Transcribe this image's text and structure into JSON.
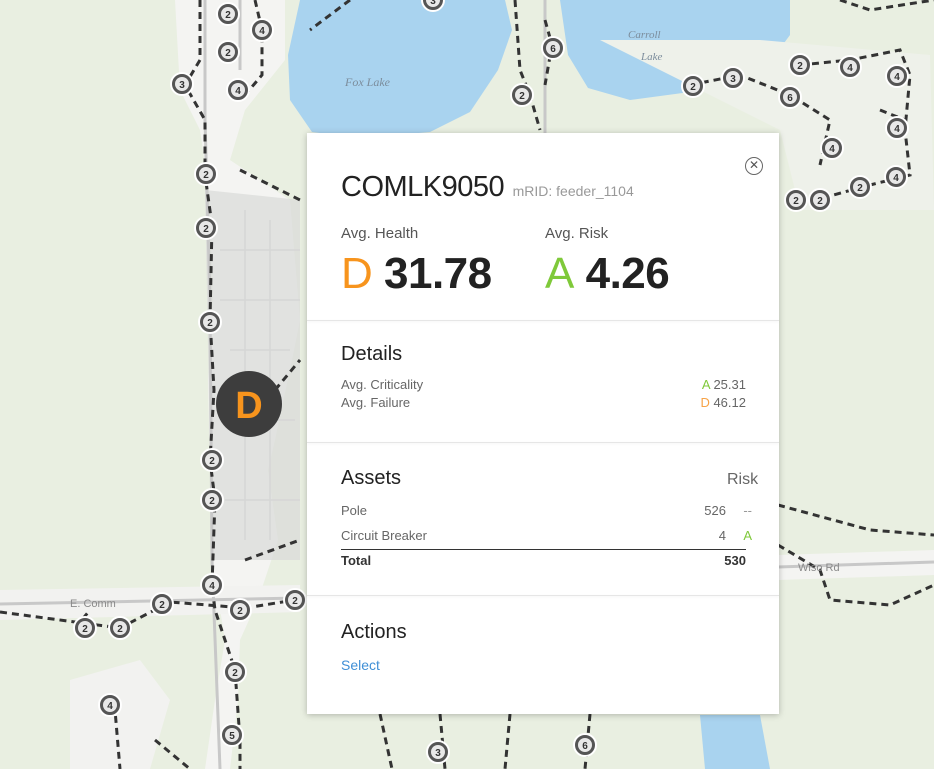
{
  "map": {
    "lakes": [
      {
        "name": "Fox Lake"
      },
      {
        "name_line1": "Carroll",
        "name_line2": "Lake"
      }
    ],
    "roads": [
      "E. Comm",
      "Wiso Rd"
    ],
    "feeder_marker_grade": "D",
    "feeder_marker_color": "#f7941d"
  },
  "popup": {
    "feeder_name": "COMLK9050",
    "mrid": "mRID: feeder_1104",
    "close_icon": "close-icon",
    "health": {
      "label": "Avg. Health",
      "grade": "D",
      "value": "31.78",
      "grade_color": "#f7941d"
    },
    "risk": {
      "label": "Avg. Risk",
      "grade": "A",
      "value": "4.26",
      "grade_color": "#7fc93a"
    },
    "details": {
      "title": "Details",
      "rows": [
        {
          "label": "Avg. Criticality",
          "grade": "A",
          "value": "25.31"
        },
        {
          "label": "Avg. Failure",
          "grade": "D",
          "value": "46.12"
        }
      ]
    },
    "assets": {
      "title": "Assets",
      "risk_header": "Risk",
      "rows": [
        {
          "label": "Pole",
          "count": "526",
          "risk": "--"
        },
        {
          "label": "Circuit Breaker",
          "count": "4",
          "risk": "A"
        }
      ],
      "total_label": "Total",
      "total_value": "530"
    },
    "actions": {
      "title": "Actions",
      "select_label": "Select"
    }
  }
}
